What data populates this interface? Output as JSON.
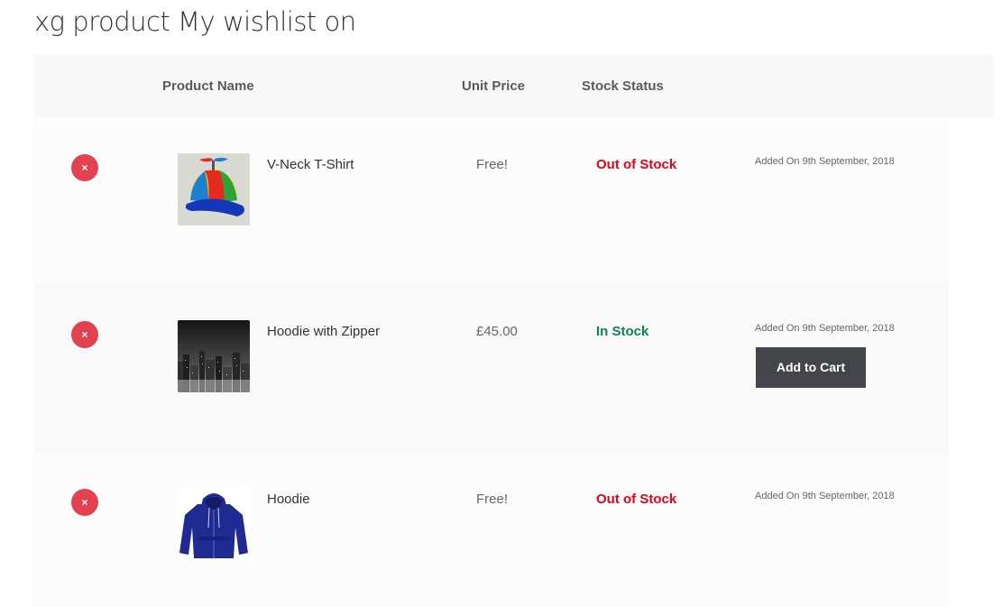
{
  "page": {
    "title": "xg product My wishlist on"
  },
  "table": {
    "headers": {
      "product_name": "Product Name",
      "unit_price": "Unit Price",
      "stock_status": "Stock Status"
    },
    "rows": [
      {
        "remove_icon": "close-icon",
        "remove_glyph": "×",
        "thumbnail": "propeller-cap-image",
        "name": "V-Neck T-Shirt",
        "price": "Free!",
        "stock": "Out of Stock",
        "stock_color": "#e2001a",
        "added_on": "Added On 9th September, 2018"
      },
      {
        "remove_icon": "close-icon",
        "remove_glyph": "×",
        "thumbnail": "city-night-image",
        "name": "Hoodie with Zipper",
        "price": "£45.00",
        "stock": "In Stock",
        "stock_color": "#0f834d",
        "added_on": "Added On 9th September, 2018",
        "add_to_cart": "Add to Cart"
      },
      {
        "remove_icon": "close-icon",
        "remove_glyph": "×",
        "thumbnail": "blue-hoodie-image",
        "name": "Hoodie",
        "price": "Free!",
        "stock": "Out of Stock",
        "stock_color": "#e2001a",
        "added_on": "Added On 9th September, 2018"
      }
    ]
  },
  "colors": {
    "remove_button": "#e2424f",
    "add_to_cart_button": "#43454b",
    "header_background": "#f8f8f8"
  }
}
